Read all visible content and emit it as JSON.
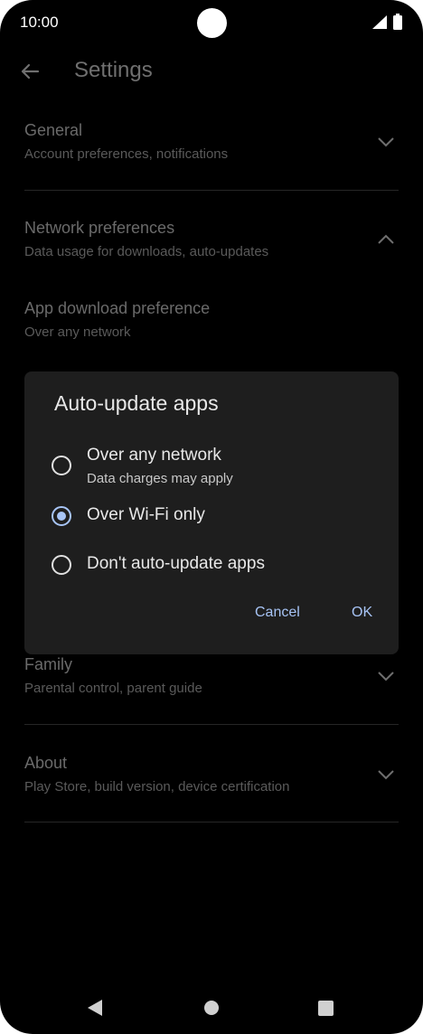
{
  "status_bar": {
    "time": "10:00",
    "signal_icon": "signal-icon",
    "battery_icon": "battery-icon"
  },
  "app_bar": {
    "title": "Settings",
    "back_icon": "back-arrow-icon"
  },
  "sections": {
    "general": {
      "title": "General",
      "subtitle": "Account preferences, notifications",
      "expanded": false
    },
    "network": {
      "title": "Network preferences",
      "subtitle": "Data usage for downloads, auto-updates",
      "expanded": true
    },
    "app_download": {
      "title": "App download preference",
      "subtitle": "Over any network"
    },
    "family": {
      "title": "Family",
      "subtitle": "Parental control, parent guide",
      "expanded": false
    },
    "about": {
      "title": "About",
      "subtitle": "Play Store, build version, device certification",
      "expanded": false
    }
  },
  "dialog": {
    "title": "Auto-update apps",
    "options": [
      {
        "label": "Over any network",
        "sublabel": "Data charges may apply",
        "selected": false
      },
      {
        "label": "Over Wi-Fi only",
        "selected": true
      },
      {
        "label": "Don't auto-update apps",
        "selected": false
      }
    ],
    "cancel_label": "Cancel",
    "ok_label": "OK",
    "accent_color": "#a7c4f5"
  },
  "nav_bar": {
    "back_icon": "triangle-back-icon",
    "home_icon": "circle-home-icon",
    "recents_icon": "square-recents-icon"
  }
}
